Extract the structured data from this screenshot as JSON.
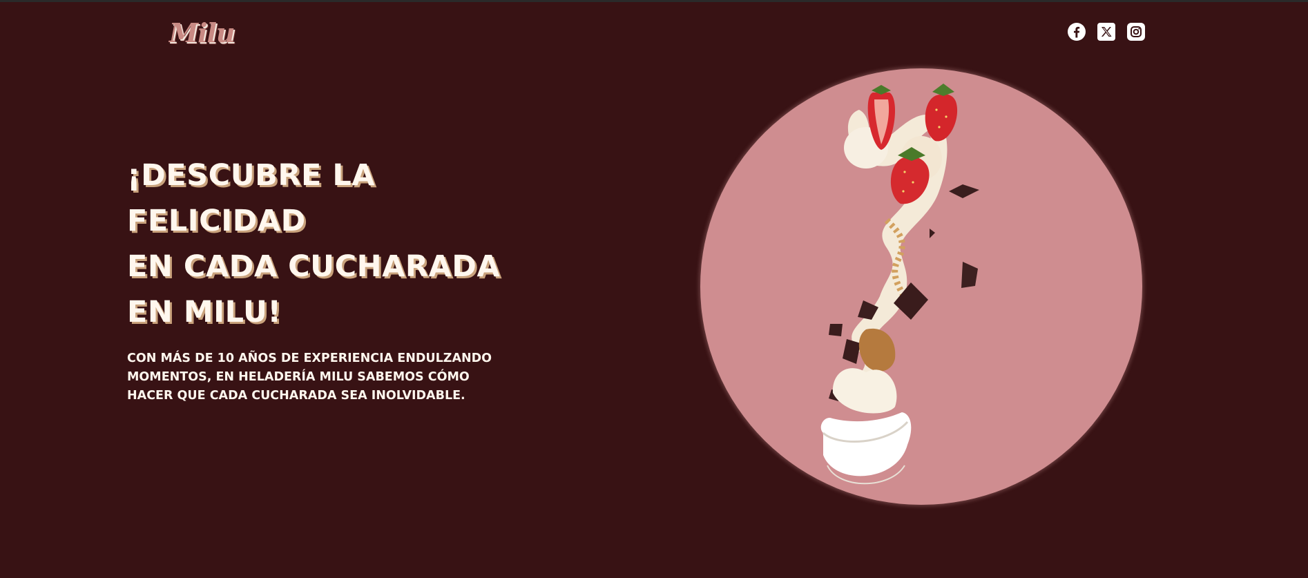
{
  "header": {
    "logo_text": "Milu",
    "socials": [
      {
        "name": "facebook-icon"
      },
      {
        "name": "x-icon"
      },
      {
        "name": "instagram-icon"
      }
    ]
  },
  "hero": {
    "title_lines": [
      "¡DESCUBRE LA",
      "FELICIDAD",
      "EN CADA CUCHARADA",
      "EN MILU!"
    ],
    "subtitle": "Con más de 10 años de experiencia endulzando momentos, en Heladería Milu sabemos cómo hacer que cada cucharada sea inolvidable."
  },
  "colors": {
    "background": "#381214",
    "circle": "#cf8d90",
    "text": "#fff7ee",
    "logo": "#c98a84"
  }
}
